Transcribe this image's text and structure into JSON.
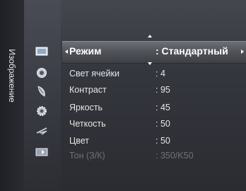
{
  "side_tab": {
    "label": "Изображение"
  },
  "icons": [
    "picture-icon",
    "sound-icon",
    "satellite-dish-icon",
    "gear-icon",
    "antenna-icon",
    "input-icon"
  ],
  "menu": {
    "items": [
      {
        "label": "Режим",
        "value": ": Стандартный",
        "selected": true
      },
      {
        "label": "Свет ячейки",
        "value": ": 4"
      },
      {
        "label": "Контраст",
        "value": ": 95"
      },
      {
        "label": "Яркость",
        "value": ": 45"
      },
      {
        "label": "Четкость",
        "value": ": 50"
      },
      {
        "label": "Цвет",
        "value": ": 50"
      },
      {
        "label": "Тон (З/К)",
        "value": ": 350/K50",
        "disabled": true
      }
    ]
  }
}
